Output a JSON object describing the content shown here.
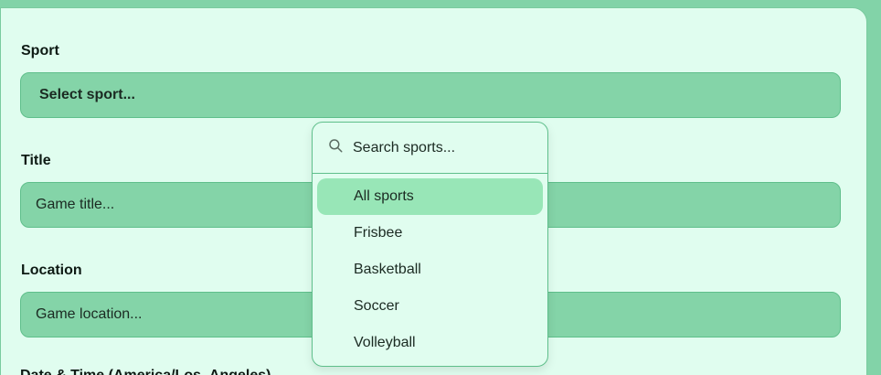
{
  "form": {
    "sport_label": "Sport",
    "sport_value": "Select sport...",
    "title_label": "Title",
    "title_placeholder": "Game title...",
    "location_label": "Location",
    "location_placeholder": "Game location...",
    "datetime_label": "Date & Time (America/Los_Angeles)"
  },
  "dropdown": {
    "search_placeholder": "Search sports...",
    "options": [
      "All sports",
      "Frisbee",
      "Basketball",
      "Soccer",
      "Volleyball"
    ],
    "highlighted": "All sports"
  },
  "colors": {
    "background": "#82d3a8",
    "card": "#e0fdef",
    "field": "#84d4a8",
    "highlight": "#98e6b7"
  },
  "icons": {
    "search": "search-icon"
  }
}
